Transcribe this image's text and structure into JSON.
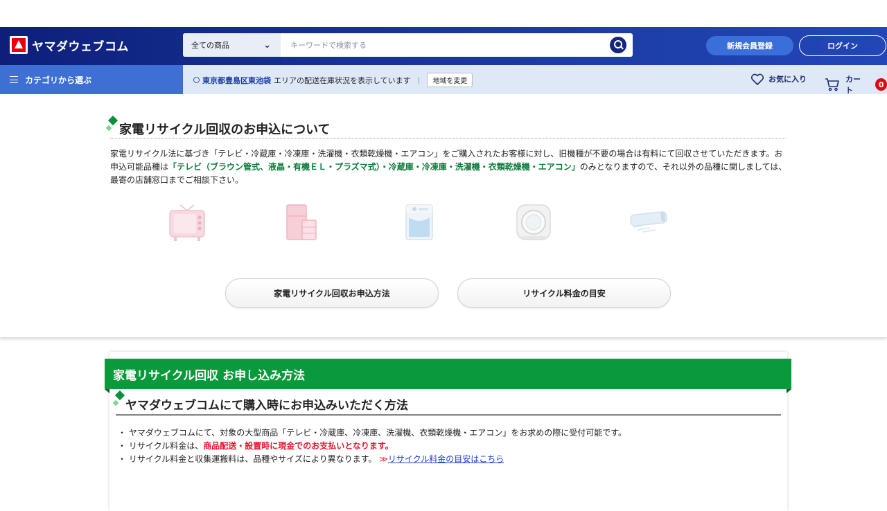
{
  "header": {
    "logo_text": "ヤマダウェブコム",
    "search_category": "全ての商品",
    "search_placeholder": "キーワードで検索する",
    "register_label": "新規会員登録",
    "login_label": "ログイン"
  },
  "subnav": {
    "category_label": "カテゴリから選ぶ",
    "area_location": "東京都豊島区東池袋",
    "area_text": "エリアの配送在庫状況を表示しています",
    "area_separator": "|",
    "change_area_label": "地域を変更",
    "favorites_label": "お気に入り",
    "cart_label": "カート",
    "cart_count": "0"
  },
  "section1": {
    "title": "家電リサイクル回収のお申込について",
    "para_part1": "家電リサイクル法に基づき「テレビ・冷蔵庫・冷凍庫・洗濯機・衣類乾燥機・エアコン」をご購入されたお客様に対し、旧機種が不要の場合は有料にて回収させていただきます。お申込可能品種は",
    "para_highlight": "「テレビ（ブラウン管式、液晶・有機ＥＬ・プラズマ式）・冷蔵庫・冷凍庫・洗濯機・衣類乾燥機・エアコン」",
    "para_part2": "のみとなりますので、それ以外の品種に関しましては、最寄の店舗窓口までご相談下さい。",
    "icons": [
      "tv-icon",
      "refrigerator-icon",
      "washing-machine-icon",
      "dryer-icon",
      "air-conditioner-icon"
    ],
    "button_method": "家電リサイクル回収お申込方法",
    "button_fee": "リサイクル料金の目安"
  },
  "section2": {
    "banner_title": "家電リサイクル回収 お申し込み方法",
    "subtitle": "ヤマダウェブコムにて購入時にお申込みいただく方法",
    "bullet1": "・ ヤマダウェブコムにて、対象の大型商品「テレビ・冷蔵庫、冷凍庫、洗濯機、衣類乾燥機・エアコン」をお求めの際に受付可能です。",
    "bullet2_prefix": "・ リサイクル料金は、",
    "bullet2_red": "商品配送・設置時に現金でのお支払いとなります。",
    "bullet3_prefix": "・ リサイクル料金と収集運搬料は、品種やサイズにより異なります。",
    "bullet3_arrow": "≫",
    "bullet3_link": "リサイクル料金の目安はこちら"
  },
  "colors": {
    "header_navy": "#0d1f7a",
    "category_blue": "#3d6fd4",
    "accent_green": "#0a9a3b",
    "alert_red": "#e6162d"
  }
}
